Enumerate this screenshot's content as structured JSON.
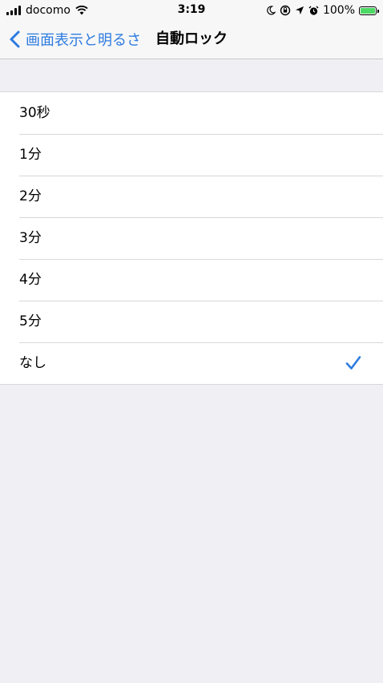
{
  "status_bar": {
    "carrier": "docomo",
    "time": "3:19",
    "battery_percent": "100%",
    "battery_level": 1.0,
    "icons": [
      "signal-bars",
      "wifi",
      "moon",
      "orientation-lock",
      "location-arrow",
      "alarm",
      "battery-charging"
    ]
  },
  "nav": {
    "back_label": "画面表示と明るさ",
    "title": "自動ロック"
  },
  "options": [
    {
      "label": "30秒",
      "selected": false
    },
    {
      "label": "1分",
      "selected": false
    },
    {
      "label": "2分",
      "selected": false
    },
    {
      "label": "3分",
      "selected": false
    },
    {
      "label": "4分",
      "selected": false
    },
    {
      "label": "5分",
      "selected": false
    },
    {
      "label": "なし",
      "selected": true
    }
  ],
  "colors": {
    "accent": "#2d7be0",
    "background": "#efeff4",
    "battery": "#4cd964"
  }
}
